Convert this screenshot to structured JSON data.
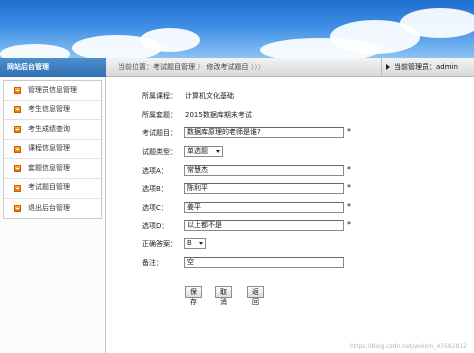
{
  "sidebar": {
    "title": "网站后台管理",
    "items": [
      {
        "label": "管理员信息管理"
      },
      {
        "label": "考生信息管理"
      },
      {
        "label": "考生成绩查询"
      },
      {
        "label": "课程信息管理"
      },
      {
        "label": "套题信息管理"
      },
      {
        "label": "考试题目管理"
      },
      {
        "label": "退出后台管理"
      }
    ]
  },
  "breadcrumb": {
    "prefix": "当前位置：",
    "crumb1": "考试题目管理",
    "sep": " 〉",
    "crumb2": "修改考试题目",
    "suffix": " 〉〉〉"
  },
  "header": {
    "current_admin": "当前管理员：admin"
  },
  "form": {
    "course_label": "所属课程：",
    "course_value": "计算机文化基础",
    "set_label": "所属套题：",
    "set_value": "2015数据库期末考试",
    "question_label": "考试题目：",
    "question_value": "数据库原理的老师是谁?",
    "type_label": "试题类型：",
    "type_value": "单选题",
    "optA_label": "选项A：",
    "optA_value": "常慧杰",
    "optB_label": "选项B：",
    "optB_value": "陈利平",
    "optC_label": "选项C：",
    "optC_value": "姜平",
    "optD_label": "选项D：",
    "optD_value": "以上都不是",
    "answer_label": "正确答案：",
    "answer_value": "B",
    "remark_label": "备注：",
    "remark_value": "空",
    "required_mark": "*",
    "save": "保存",
    "cancel": "取消",
    "back": "返回"
  },
  "watermark": "https://blog.csdn.net/weixin_43582812",
  "icons": {
    "nav_arrow": "triangle-right-icon",
    "menu_item": "orange-square-icon",
    "select_caret": "chevron-down-icon"
  },
  "colors": {
    "sidebar_header": "#2f6fb2",
    "menu_icon": "#e57a00",
    "banner_sky": "#3e8ee6"
  }
}
